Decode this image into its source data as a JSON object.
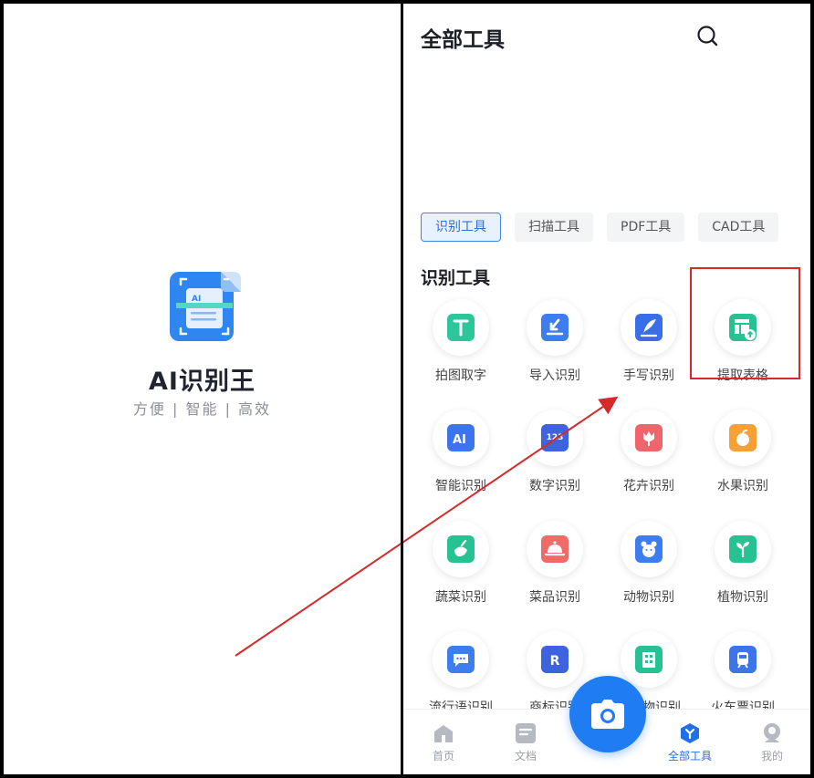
{
  "splash": {
    "app_name": "AI识别王",
    "tagline": "方便 | 智能 | 高效",
    "logo_text": "AI"
  },
  "header": {
    "title": "全部工具",
    "search_icon": "search-icon"
  },
  "tabs": [
    "识别工具",
    "扫描工具",
    "PDF工具",
    "CAD工具"
  ],
  "active_tab": "识别工具",
  "section": {
    "title": "识别工具"
  },
  "tools": [
    {
      "label": "拍图取字",
      "icon": "photo-text-icon",
      "color": "#2bc69a"
    },
    {
      "label": "导入识别",
      "icon": "import-icon",
      "color": "#3d7df0"
    },
    {
      "label": "手写识别",
      "icon": "handwrite-icon",
      "color": "#3a6ee8"
    },
    {
      "label": "提取表格",
      "icon": "table-extract-icon",
      "color": "#27c293"
    },
    {
      "label": "智能识别",
      "icon": "ai-icon",
      "color": "#3b74ec"
    },
    {
      "label": "数字识别",
      "icon": "number-icon",
      "color": "#3d63df",
      "badge": "123"
    },
    {
      "label": "花卉识别",
      "icon": "flower-icon",
      "color": "#f0646b"
    },
    {
      "label": "水果识别",
      "icon": "fruit-icon",
      "color": "#f7a036"
    },
    {
      "label": "蔬菜识别",
      "icon": "vegetable-icon",
      "color": "#27c293"
    },
    {
      "label": "菜品识别",
      "icon": "dish-icon",
      "color": "#f06a66"
    },
    {
      "label": "动物识别",
      "icon": "animal-icon",
      "color": "#3d7df0"
    },
    {
      "label": "植物识别",
      "icon": "plant-icon",
      "color": "#27c293"
    },
    {
      "label": "流行语识别",
      "icon": "slang-icon",
      "color": "#3d7df0"
    },
    {
      "label": "商标识别",
      "icon": "trademark-icon",
      "color": "#3d63df",
      "badge": "R"
    },
    {
      "label": "建筑物识别",
      "icon": "building-icon",
      "color": "#27c293"
    },
    {
      "label": "火车票识别",
      "icon": "train-ticket-icon",
      "color": "#3d74ea"
    }
  ],
  "nav": {
    "home": "首页",
    "docs": "文档",
    "all_tools": "全部工具",
    "mine": "我的",
    "active": "全部工具"
  },
  "colors": {
    "accent": "#1f7cf2",
    "annotation": "#d62a2a"
  }
}
